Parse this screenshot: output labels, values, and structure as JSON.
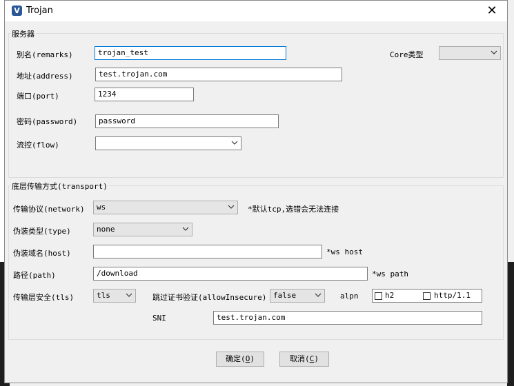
{
  "window": {
    "title": "Trojan",
    "close_glyph": "✕",
    "icon_letter": "V"
  },
  "server": {
    "group_title": "服务器",
    "remarks_label": "别名(remarks)",
    "remarks_value": "trojan_test",
    "core_type_label": "Core类型",
    "core_type_value": "",
    "address_label": "地址(address)",
    "address_value": "test.trojan.com",
    "port_label": "端口(port)",
    "port_value": "1234",
    "password_label": "密码(password)",
    "password_value": "password",
    "flow_label": "流控(flow)",
    "flow_value": ""
  },
  "transport": {
    "group_title": "底层传输方式(transport)",
    "network_label": "传输协议(network)",
    "network_value": "ws",
    "network_hint": "*默认tcp,选错会无法连接",
    "type_label": "伪装类型(type)",
    "type_value": "none",
    "host_label": "伪装域名(host)",
    "host_value": "",
    "host_hint": "*ws host",
    "path_label": "路径(path)",
    "path_value": "/download",
    "path_hint": "*ws path",
    "tls_label": "传输层安全(tls)",
    "tls_value": "tls",
    "allow_insecure_label": "跳过证书验证(allowInsecure)",
    "allow_insecure_value": "false",
    "alpn_label": "alpn",
    "alpn_options": [
      "h2",
      "http/1.1"
    ],
    "sni_label": "SNI",
    "sni_value": "test.trojan.com"
  },
  "buttons": {
    "ok_text": "确定(",
    "ok_key": "O",
    "cancel_text": "取消(",
    "cancel_key": "C",
    "close_paren": ")"
  },
  "colors": {
    "focus_border": "#0078d7",
    "icon_bg": "#2b5797"
  }
}
